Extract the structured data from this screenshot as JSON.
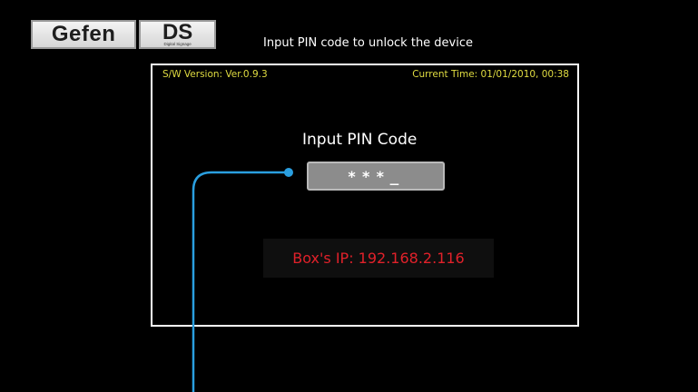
{
  "logo": {
    "brand": "Gefen",
    "product": "DS",
    "product_sub": "Digital Signage"
  },
  "header": {
    "prompt": "Input PIN code to unlock the device"
  },
  "panel": {
    "sw_version": "S/W Version: Ver.0.9.3",
    "current_time": "Current Time: 01/01/2010, 00:38",
    "pin_title": "Input PIN Code",
    "pin_value": "***_",
    "ip_text": "Box's IP: 192.168.2.116"
  },
  "colors": {
    "background": "#000000",
    "version_text": "#e0dc41",
    "ip_text": "#e0212a",
    "callout": "#2a9fe0"
  }
}
